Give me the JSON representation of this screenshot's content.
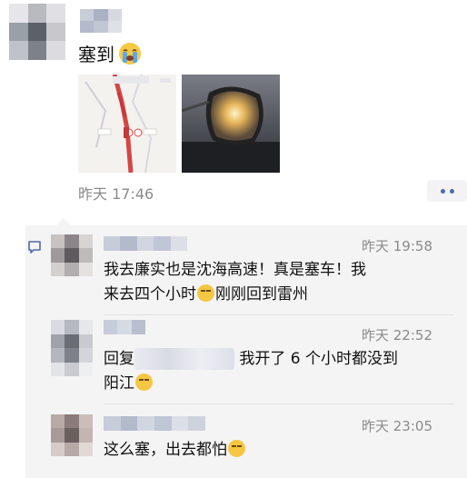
{
  "post": {
    "text": "塞到",
    "emoji": "crying-face",
    "time": "昨天 17:46"
  },
  "comment_icon": "comment-bubble-icon",
  "comments": [
    {
      "time": "昨天 19:58",
      "line1": "我去廉实也是沈海高速！真是塞车！我",
      "line2a": "来去四个小时",
      "line2b": "刚刚回到雷州"
    },
    {
      "time": "昨天 22:52",
      "prefix": "回复",
      "after": "我开了 6 个小时都没到",
      "line2": "阳江"
    },
    {
      "time": "昨天 23:05",
      "text": "这么塞，出去都怕"
    }
  ],
  "colors": {
    "link": "#4f6aa6",
    "panel": "#f4f4f5",
    "route_red": "#d64545"
  }
}
